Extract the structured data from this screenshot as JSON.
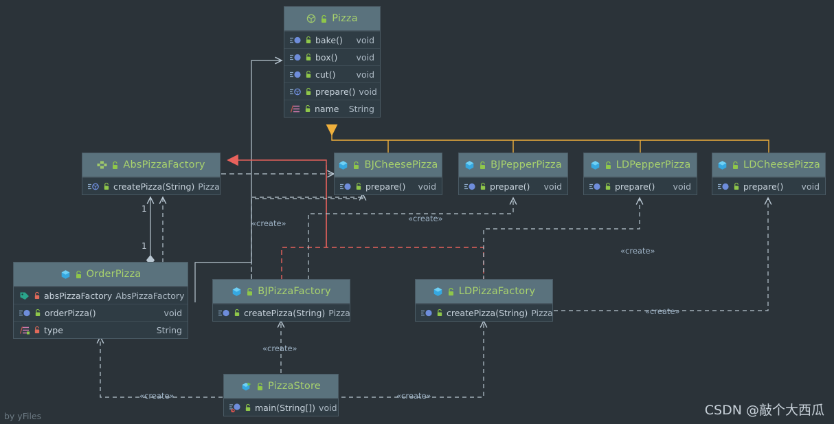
{
  "diagram": {
    "background": "#2b3339",
    "header_color": "#5a727d",
    "body_color": "#2f3c44",
    "class_name_color": "#a8d26d",
    "member_color": "#c8d3dc",
    "edge_color": "#b9c7d2",
    "highlight_red": "#e8625c",
    "highlight_orange": "#f0b03c"
  },
  "classes": {
    "pizza": {
      "name": "Pizza",
      "icon": "abstract-class-icon",
      "lock": "lock-green-icon",
      "members": [
        {
          "icon": "abstract-method-icon",
          "lock": "lock-green-icon",
          "name": "bake()",
          "type": "void"
        },
        {
          "icon": "abstract-method-icon",
          "lock": "lock-green-icon",
          "name": "box()",
          "type": "void"
        },
        {
          "icon": "abstract-method-icon",
          "lock": "lock-green-icon",
          "name": "cut()",
          "type": "void"
        },
        {
          "icon": "abstract-method-icon",
          "lock": "lock-green-icon",
          "name": "prepare()",
          "type": "void"
        },
        {
          "icon": "field-icon",
          "lock": "lock-green-icon",
          "name": "name",
          "type": "String"
        }
      ]
    },
    "abspizzafactory": {
      "name": "AbsPizzaFactory",
      "icon": "interface-icon",
      "lock": "lock-green-icon",
      "members": [
        {
          "icon": "abstract-method-icon",
          "lock": "lock-green-icon",
          "name": "createPizza(String)",
          "type": "Pizza"
        }
      ]
    },
    "bjcheesepizza": {
      "name": "BJCheesePizza",
      "icon": "class-icon",
      "lock": "lock-green-icon",
      "members": [
        {
          "icon": "method-icon",
          "lock": "lock-green-icon",
          "name": "prepare()",
          "type": "void"
        }
      ]
    },
    "bjpepperpizza": {
      "name": "BJPepperPizza",
      "icon": "class-icon",
      "lock": "lock-green-icon",
      "members": [
        {
          "icon": "method-icon",
          "lock": "lock-green-icon",
          "name": "prepare()",
          "type": "void"
        }
      ]
    },
    "ldpepperpizza": {
      "name": "LDPepperPizza",
      "icon": "class-icon",
      "lock": "lock-green-icon",
      "members": [
        {
          "icon": "method-icon",
          "lock": "lock-green-icon",
          "name": "prepare()",
          "type": "void"
        }
      ]
    },
    "ldcheesepizza": {
      "name": "LDCheesePizza",
      "icon": "class-icon",
      "lock": "lock-green-icon",
      "members": [
        {
          "icon": "method-icon",
          "lock": "lock-green-icon",
          "name": "prepare()",
          "type": "void"
        }
      ]
    },
    "orderpizza": {
      "name": "OrderPizza",
      "icon": "class-icon",
      "lock": "lock-green-icon",
      "members": [
        {
          "icon": "property-icon",
          "lock": "lock-red-icon",
          "name": "absPizzaFactory",
          "type": "AbsPizzaFactory"
        },
        {
          "icon": "method-icon",
          "lock": "lock-green-icon",
          "name": "orderPizza()",
          "type": "void"
        },
        {
          "icon": "field-icon",
          "lock": "lock-red-icon",
          "name": "type",
          "type": "String"
        }
      ]
    },
    "bjpizzafactory": {
      "name": "BJPizzaFactory",
      "icon": "class-icon",
      "lock": "lock-green-icon",
      "members": [
        {
          "icon": "method-icon",
          "lock": "lock-green-icon",
          "name": "createPizza(String)",
          "type": "Pizza"
        }
      ]
    },
    "ldpizzafactory": {
      "name": "LDPizzaFactory",
      "icon": "class-icon",
      "lock": "lock-green-icon",
      "members": [
        {
          "icon": "method-icon",
          "lock": "lock-green-icon",
          "name": "createPizza(String)",
          "type": "Pizza"
        }
      ]
    },
    "pizzastore": {
      "name": "PizzaStore",
      "icon": "runnable-class-icon",
      "lock": "lock-green-icon",
      "members": [
        {
          "icon": "main-method-icon",
          "lock": "lock-green-icon",
          "name": "main(String[])",
          "type": "void"
        }
      ]
    }
  },
  "edge_labels": {
    "create_1": "«create»",
    "create_2": "«create»",
    "create_3": "«create»",
    "create_4": "«create»",
    "create_5": "«create»",
    "create_6": "«create»",
    "create_7": "«create»"
  },
  "multiplicities": {
    "top": "1",
    "bottom": "1"
  },
  "watermarks": {
    "yfiles": "by yFiles",
    "csdn": "CSDN @敲个大西瓜"
  }
}
